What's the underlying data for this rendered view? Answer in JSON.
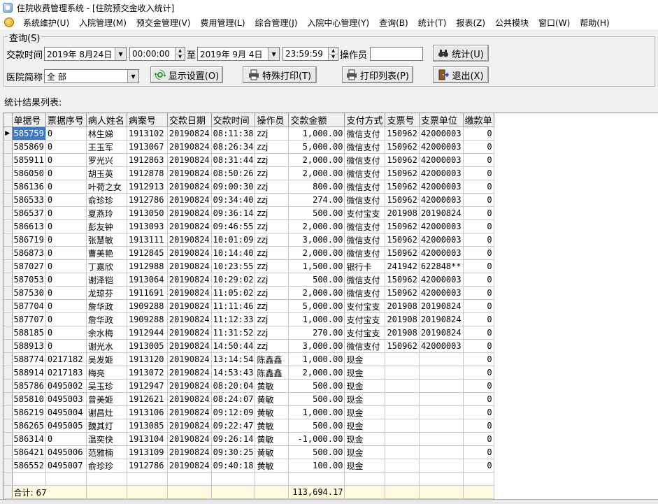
{
  "window": {
    "title": "住院收费管理系统 - [住院预交金收入统计]"
  },
  "menu": [
    "系统维护(U)",
    "入院管理(M)",
    "预交金管理(V)",
    "费用管理(L)",
    "综合管理(J)",
    "入院中心管理(Y)",
    "查询(B)",
    "统计(T)",
    "报表(Z)",
    "公共模块",
    "窗口(W)",
    "帮助(H)"
  ],
  "query": {
    "group_title": "查询(S)",
    "pay_time_label": "交款时间",
    "start_date": "2019年 8月24日",
    "start_time": "00:00:00",
    "to_label": "至",
    "end_date": "2019年 9月 4日",
    "end_time": "23:59:59",
    "operator_label": "操作员",
    "operator_value": "",
    "stats_button": "统计(U)",
    "hospital_label": "医院简称",
    "hospital_value": "全 部",
    "display_settings_button": "显示设置(O)",
    "special_print_button": "特殊打印(T)",
    "print_list_button": "打印列表(P)",
    "exit_button": "退出(X)"
  },
  "results": {
    "title": "统计结果列表:",
    "columns": [
      "单据号",
      "票据序号",
      "病人姓名",
      "病案号",
      "交款日期",
      "交款时间",
      "操作员",
      "交款金额",
      "支付方式",
      "支票号",
      "支票单位",
      "缴款单"
    ],
    "rows": [
      [
        "585759",
        "0",
        "林生娣",
        "1913102",
        "20190824",
        "08:11:38",
        "zzj",
        "1,000.00",
        "微信支付",
        "150962",
        "42000003",
        "0"
      ],
      [
        "585869",
        "0",
        "王玉军",
        "1913067",
        "20190824",
        "08:26:34",
        "zzj",
        "5,000.00",
        "微信支付",
        "150962",
        "42000003",
        "0"
      ],
      [
        "585911",
        "0",
        "罗光兴",
        "1912863",
        "20190824",
        "08:31:44",
        "zzj",
        "2,000.00",
        "微信支付",
        "150962",
        "42000003",
        "0"
      ],
      [
        "586050",
        "0",
        "胡玉英",
        "1912878",
        "20190824",
        "08:50:26",
        "zzj",
        "2,000.00",
        "微信支付",
        "150962",
        "42000003",
        "0"
      ],
      [
        "586136",
        "0",
        "叶荷之女",
        "1912913",
        "20190824",
        "09:00:30",
        "zzj",
        "800.00",
        "微信支付",
        "150962",
        "42000003",
        "0"
      ],
      [
        "586533",
        "0",
        "俞珍珍",
        "1912786",
        "20190824",
        "09:34:40",
        "zzj",
        "274.00",
        "微信支付",
        "150962",
        "42000003",
        "0"
      ],
      [
        "586537",
        "0",
        "夏燕玲",
        "1913050",
        "20190824",
        "09:36:14",
        "zzj",
        "500.00",
        "支付宝支",
        "201908",
        "20190824",
        "0"
      ],
      [
        "586613",
        "0",
        "彭友钟",
        "1913093",
        "20190824",
        "09:46:55",
        "zzj",
        "2,000.00",
        "微信支付",
        "150962",
        "42000003",
        "0"
      ],
      [
        "586719",
        "0",
        "张慧敏",
        "1913111",
        "20190824",
        "10:01:09",
        "zzj",
        "3,000.00",
        "微信支付",
        "150962",
        "42000003",
        "0"
      ],
      [
        "586873",
        "0",
        "曹美艳",
        "1912845",
        "20190824",
        "10:14:40",
        "zzj",
        "2,000.00",
        "微信支付",
        "150962",
        "42000003",
        "0"
      ],
      [
        "587027",
        "0",
        "丁嘉欣",
        "1912988",
        "20190824",
        "10:23:55",
        "zzj",
        "1,500.00",
        "银行卡",
        "241942",
        "622848**",
        "0"
      ],
      [
        "587053",
        "0",
        "谢泽铠",
        "1913064",
        "20190824",
        "10:29:02",
        "zzj",
        "500.00",
        "微信支付",
        "150962",
        "42000003",
        "0"
      ],
      [
        "587530",
        "0",
        "龙琼芬",
        "1911691",
        "20190824",
        "11:05:02",
        "zzj",
        "2,000.00",
        "微信支付",
        "150962",
        "42000003",
        "0"
      ],
      [
        "587704",
        "0",
        "詹华政",
        "1909288",
        "20190824",
        "11:11:46",
        "zzj",
        "5,000.00",
        "支付宝支",
        "201908",
        "20190824",
        "0"
      ],
      [
        "587707",
        "0",
        "詹华政",
        "1909288",
        "20190824",
        "11:12:33",
        "zzj",
        "1,000.00",
        "支付宝支",
        "201908",
        "20190824",
        "0"
      ],
      [
        "588185",
        "0",
        "余水梅",
        "1912944",
        "20190824",
        "11:31:52",
        "zzj",
        "270.00",
        "支付宝支",
        "201908",
        "20190824",
        "0"
      ],
      [
        "588913",
        "0",
        "谢光水",
        "1913005",
        "20190824",
        "14:50:44",
        "zzj",
        "3,000.00",
        "微信支付",
        "150962",
        "42000003",
        "0"
      ],
      [
        "588774",
        "0217182",
        "吴发姬",
        "1913120",
        "20190824",
        "13:14:54",
        "陈鑫鑫",
        "1,000.00",
        "现金",
        "",
        "",
        "0"
      ],
      [
        "588914",
        "0217183",
        "梅亮",
        "1913072",
        "20190824",
        "14:53:43",
        "陈鑫鑫",
        "2,000.00",
        "现金",
        "",
        "",
        "0"
      ],
      [
        "585786",
        "0495002",
        "吴玉珍",
        "1912947",
        "20190824",
        "08:20:04",
        "黄敏",
        "500.00",
        "现金",
        "",
        "",
        "0"
      ],
      [
        "585810",
        "0495003",
        "曾美姬",
        "1912621",
        "20190824",
        "08:24:07",
        "黄敏",
        "500.00",
        "现金",
        "",
        "",
        "0"
      ],
      [
        "586219",
        "0495004",
        "谢昌灶",
        "1913106",
        "20190824",
        "09:12:09",
        "黄敏",
        "1,000.00",
        "现金",
        "",
        "",
        "0"
      ],
      [
        "586265",
        "0495005",
        "魏其灯",
        "1913085",
        "20190824",
        "09:22:47",
        "黄敏",
        "500.00",
        "现金",
        "",
        "",
        "0"
      ],
      [
        "586314",
        "0",
        "温奕快",
        "1913104",
        "20190824",
        "09:26:14",
        "黄敏",
        "-1,000.00",
        "现金",
        "",
        "",
        "0"
      ],
      [
        "586421",
        "0495006",
        "范雅楠",
        "1913109",
        "20190824",
        "09:30:25",
        "黄敏",
        "500.00",
        "现金",
        "",
        "",
        "0"
      ],
      [
        "586552",
        "0495007",
        "俞珍珍",
        "1912786",
        "20190824",
        "09:40:18",
        "黄敏",
        "100.00",
        "现金",
        "",
        "",
        "0"
      ]
    ],
    "total_label": "合计:",
    "total_count": "67",
    "total_amount": "113,694.17"
  },
  "colors": {
    "selection": "#3c78c8",
    "total_row": "#fffbe0"
  }
}
